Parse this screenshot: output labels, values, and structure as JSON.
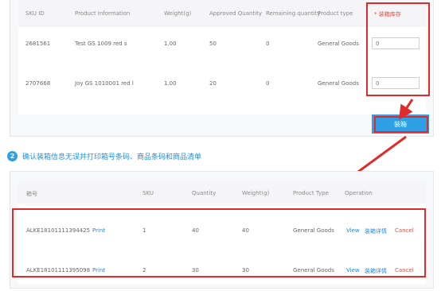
{
  "table1": {
    "headers": {
      "sku_id": "SKU ID",
      "product_info": "Product Information",
      "weight": "Weight(g)",
      "approved_qty": "Approved Quantity",
      "remaining_qty": "Remaining quantity",
      "product_type": "Product type",
      "box_stock": "* 装箱库存"
    },
    "rows": [
      {
        "sku_id": "2681561",
        "product_info": "Test GS 1009 red s",
        "weight": "1.00",
        "approved_qty": "50",
        "remaining_qty": "0",
        "product_type": "General Goods",
        "box_stock": "0"
      },
      {
        "sku_id": "2707668",
        "product_info": "Joy GS 1010001 red l",
        "weight": "1.00",
        "approved_qty": "20",
        "remaining_qty": "0",
        "product_type": "General Goods",
        "box_stock": "0"
      }
    ]
  },
  "pack_button": "装箱",
  "step2": {
    "number": "2",
    "text": "确认装箱信息无误并打印箱号条码、商品条码和商品清单"
  },
  "table2": {
    "headers": {
      "box_no": "箱号",
      "sku": "SKU",
      "quantity": "Quantity",
      "weight": "Weight(g)",
      "product_type": "Product Type",
      "operation": "Operation"
    },
    "rows": [
      {
        "box_no": "ALKE18101111394425",
        "print": "Print",
        "sku": "1",
        "quantity": "40",
        "weight": "40",
        "product_type": "General Goods",
        "view": "View",
        "detail": "装箱详情",
        "cancel": "Cancel"
      },
      {
        "box_no": "ALKE18101111395098",
        "print": "Print",
        "sku": "2",
        "quantity": "30",
        "weight": "30",
        "product_type": "General Goods",
        "view": "View",
        "detail": "装箱详情",
        "cancel": "Cancel"
      }
    ]
  },
  "colors": {
    "accent": "#2ea0e6",
    "highlight": "#e12a2a",
    "link": "#2b8ad6",
    "cancel": "#e0504a"
  }
}
